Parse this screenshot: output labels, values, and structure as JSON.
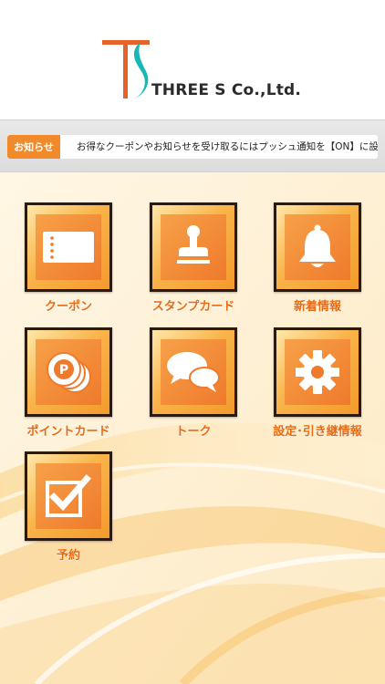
{
  "header": {
    "logo_text": "THREE S Co.,Ltd.",
    "brand_orange": "#e5622b",
    "brand_teal": "#18b7b5"
  },
  "notice": {
    "badge": "お知らせ",
    "text": "お得なクーポンやお知らせを受け取るにはプッシュ通知を【ON】に設定"
  },
  "menu": {
    "coupon": {
      "label": "クーポン",
      "icon": "ticket-icon"
    },
    "stamp_card": {
      "label": "スタンプカード",
      "icon": "stamp-icon"
    },
    "news": {
      "label": "新着情報",
      "icon": "bell-icon"
    },
    "point_card": {
      "label": "ポイントカード",
      "icon": "coins-icon"
    },
    "talk": {
      "label": "トーク",
      "icon": "chat-bubbles-icon"
    },
    "settings": {
      "label": "設定･引き継情報",
      "icon": "gear-icon"
    },
    "reservation": {
      "label": "予約",
      "icon": "checkbox-icon"
    }
  },
  "colors": {
    "accent": "#ea6a12",
    "tile_frame": "#2a1a12",
    "notice_badge": "#f08a2a"
  }
}
